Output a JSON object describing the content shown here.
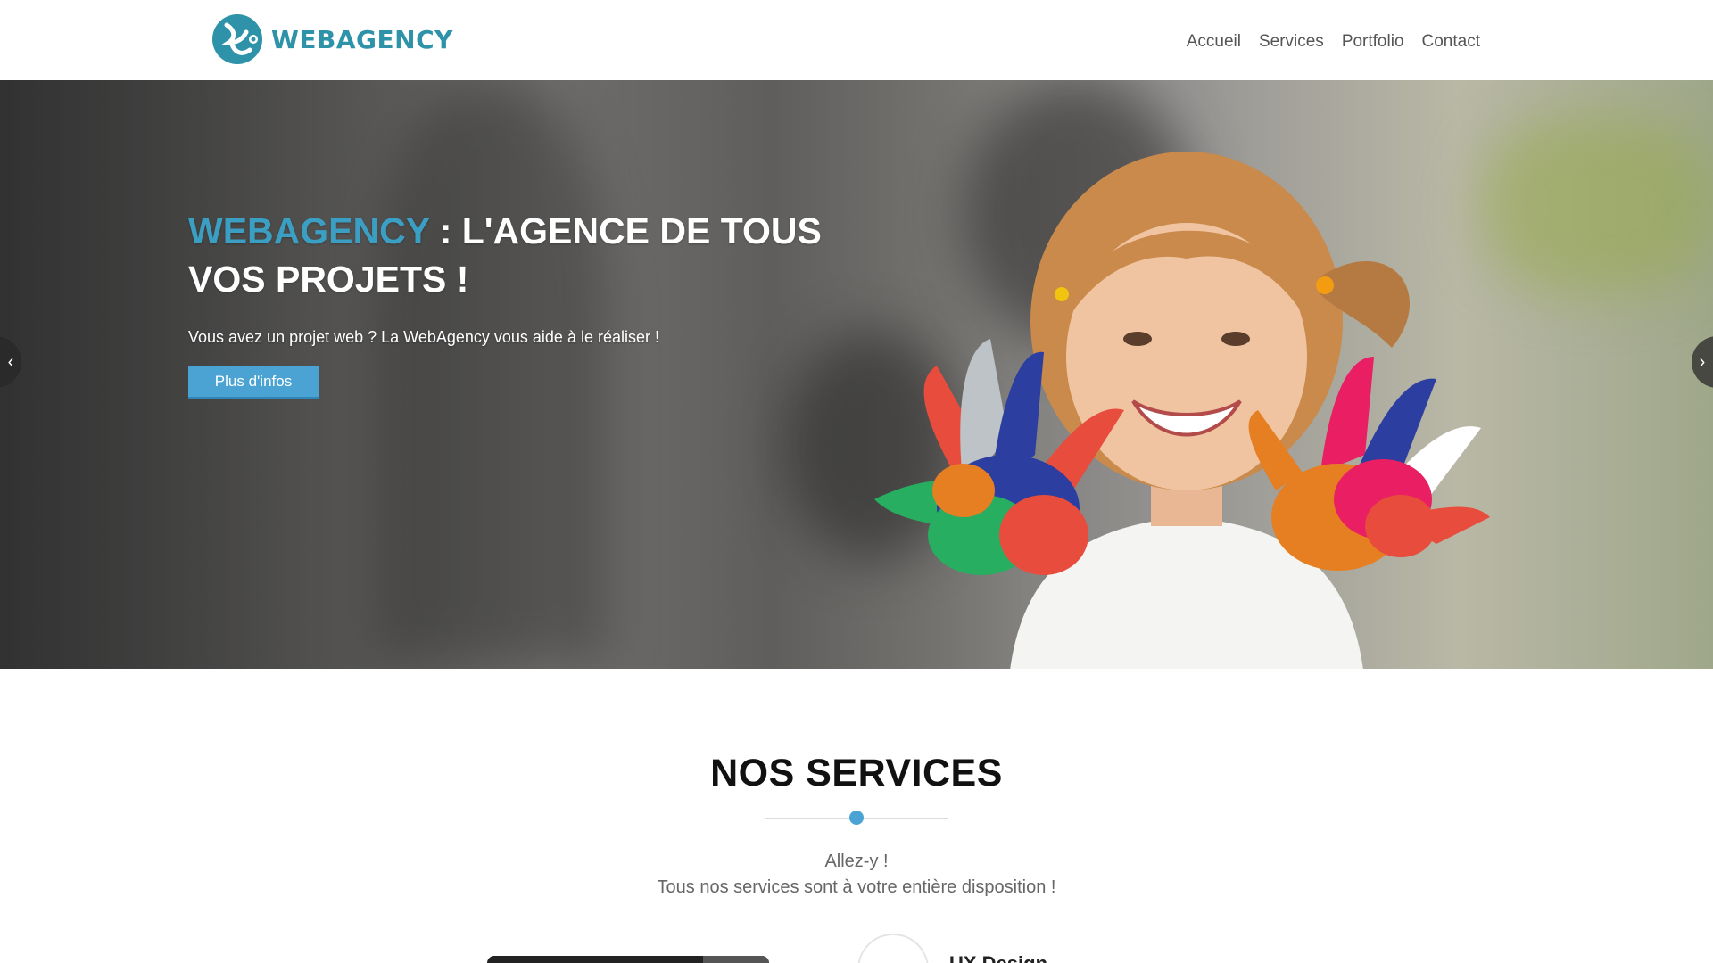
{
  "brand": {
    "name": "WEBAGENCY",
    "color": "#2e93a8"
  },
  "nav": {
    "items": [
      "Accueil",
      "Services",
      "Portfolio",
      "Contact"
    ]
  },
  "hero": {
    "title_accent": "WEBAGENCY",
    "title_rest": " : L'AGENCE DE TOUS VOS PROJETS !",
    "subtitle": "Vous avez un projet web ? La WebAgency vous aide à le réaliser !",
    "button_label": "Plus d'infos",
    "accent_color": "#3b9fc4",
    "prev_icon": "chevron-left-icon",
    "next_icon": "chevron-right-icon"
  },
  "services": {
    "title": "NOS SERVICES",
    "subtitle_line1": "Allez-y !",
    "subtitle_line2": "Tous nos services sont à votre entière disposition !",
    "first_service_title": "UX Design"
  }
}
